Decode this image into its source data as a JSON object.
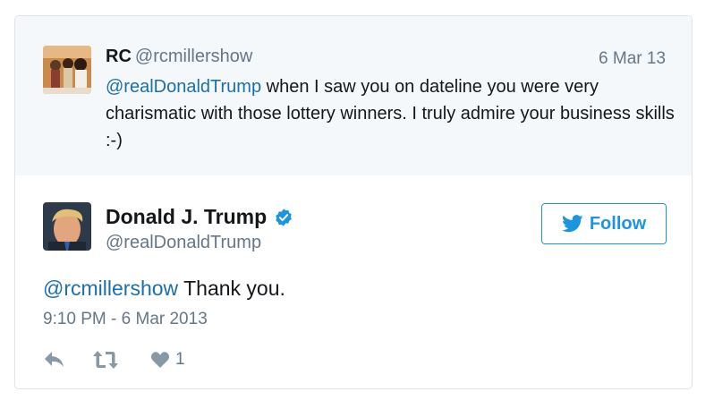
{
  "parent_tweet": {
    "name": "RC",
    "handle": "@rcmillershow",
    "date": "6 Mar 13",
    "mention": "@realDonaldTrump",
    "text": " when I saw you on dateline you were very charismatic with those lottery winners. I truly admire your business skills :-)"
  },
  "main_tweet": {
    "name": "Donald J. Trump",
    "handle": "@realDonaldTrump",
    "verified": true,
    "mention": "@rcmillershow",
    "text": " Thank you.",
    "timestamp": "9:10 PM - 6 Mar 2013",
    "like_count": "1"
  },
  "follow_button": {
    "label": "Follow"
  },
  "icons": {
    "verified": "verified-badge-icon",
    "follow": "twitter-bird-icon",
    "reply": "reply-icon",
    "retweet": "retweet-icon",
    "like": "heart-icon"
  },
  "colors": {
    "link": "#1b6fab",
    "brand": "#1b95e0",
    "muted": "#657786",
    "parent_bg": "#f5f8fa"
  }
}
